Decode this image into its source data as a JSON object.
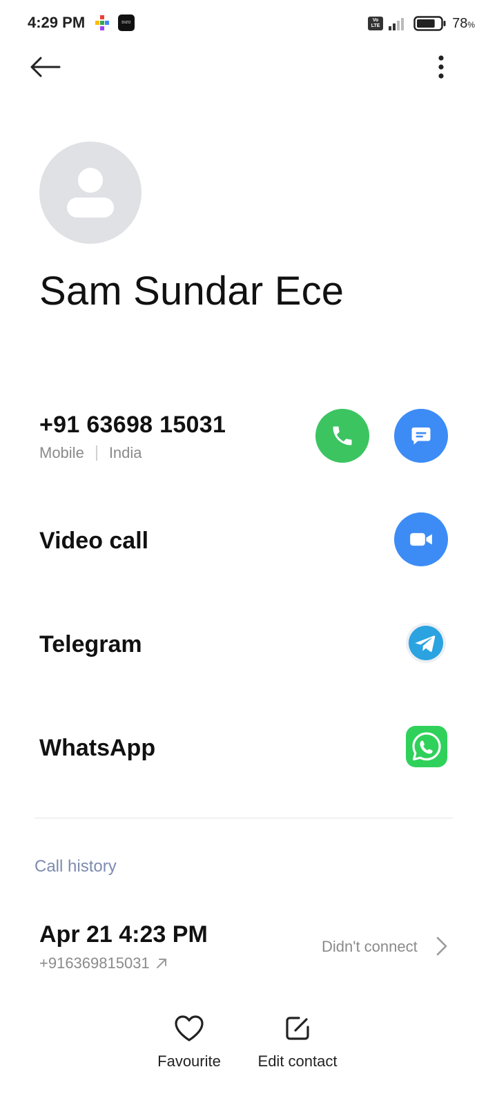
{
  "status_bar": {
    "time": "4:29 PM",
    "app_badge": "DIZO",
    "network": "Vo LTE",
    "battery_percent": "78",
    "battery_unit": "%",
    "battery_level": 0.78
  },
  "contact": {
    "name": "Sam Sundar Ece",
    "phone_number": "+91 63698 15031",
    "phone_type": "Mobile",
    "phone_region": "India"
  },
  "rows": {
    "video_call": "Video call",
    "telegram": "Telegram",
    "whatsapp": "WhatsApp"
  },
  "call_history": {
    "title": "Call history",
    "entries": [
      {
        "datetime": "Apr 21 4:23 PM",
        "number": "+916369815031",
        "status": "Didn't connect",
        "direction": "outgoing"
      }
    ]
  },
  "bottom_actions": {
    "favourite": "Favourite",
    "edit_contact": "Edit contact"
  },
  "colors": {
    "call_green": "#3cc461",
    "action_blue": "#3d8cf5",
    "whatsapp_green": "#2fd15b",
    "telegram_blue": "#2aa3e0",
    "section_title": "#7d8bb0",
    "avatar_gray": "#dfe1e5"
  },
  "icons": {
    "back": "arrow-left-icon",
    "more": "more-vertical-icon",
    "avatar": "person-placeholder-icon",
    "call": "phone-icon",
    "message": "message-icon",
    "video": "video-camera-icon",
    "telegram": "telegram-icon",
    "whatsapp": "whatsapp-icon",
    "outgoing": "outgoing-arrow-icon",
    "chevron": "chevron-right-icon",
    "favourite": "heart-icon",
    "edit": "edit-icon"
  }
}
